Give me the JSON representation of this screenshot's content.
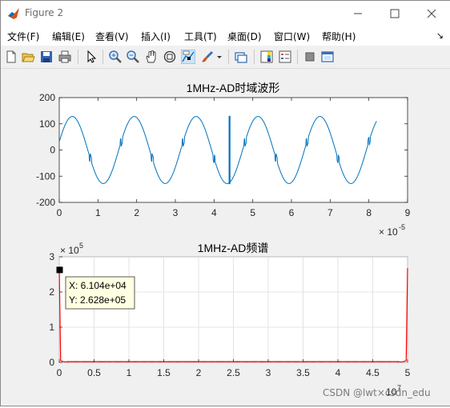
{
  "window": {
    "title": "Figure 2"
  },
  "menu": {
    "items": [
      "文件(F)",
      "编辑(E)",
      "查看(V)",
      "插入(I)",
      "工具(T)",
      "桌面(D)",
      "窗口(W)",
      "帮助(H)"
    ],
    "overflow_glyph": "↘"
  },
  "toolbar": {
    "icons": [
      "new-figure-icon",
      "open-file-icon",
      "save-icon",
      "print-icon",
      "pointer-icon",
      "zoom-in-icon",
      "zoom-out-icon",
      "pan-icon",
      "rotate-3d-icon",
      "data-cursor-icon",
      "brush-icon",
      "brush-dropdown-icon",
      "link-plot-icon",
      "insert-colorbar-icon",
      "insert-legend-icon",
      "hide-plot-tools-icon",
      "show-plot-tools-icon"
    ]
  },
  "chart_data": [
    {
      "type": "line",
      "title": "1MHz-AD时域波形",
      "xlabel": "",
      "ylabel": "",
      "xlim": [
        0,
        9
      ],
      "ylim": [
        -200,
        200
      ],
      "x_multiplier_label": "× 10",
      "x_multiplier_exponent": "-5",
      "xticks": [
        "0",
        "1",
        "2",
        "3",
        "4",
        "5",
        "6",
        "7",
        "8",
        "9"
      ],
      "yticks": [
        "200",
        "100",
        "0",
        "-100",
        "-200"
      ],
      "grid": false,
      "color": "#0072bd",
      "series": [
        {
          "description_free": true,
          "amplitude": 128,
          "period_x": 1.6,
          "x_end": 8.2,
          "glitch_x": [
            0.8,
            1.6,
            2.4,
            3.2,
            4.0,
            4.8,
            5.6,
            6.4,
            7.2,
            8.0
          ],
          "spike_x": 4.4,
          "spike_range": [
            -130,
            130
          ]
        }
      ]
    },
    {
      "type": "line",
      "title": "1MHz-AD频谱",
      "xlabel": "",
      "ylabel": "",
      "xlim": [
        0,
        5
      ],
      "ylim": [
        0,
        3
      ],
      "x_multiplier_label": "10",
      "x_multiplier_exponent": "7",
      "y_multiplier_label": "× 10",
      "y_multiplier_exponent": "5",
      "xticks": [
        "0",
        "0.5",
        "1",
        "1.5",
        "2",
        "2.5",
        "3",
        "3.5",
        "4",
        "4.5",
        "5"
      ],
      "yticks": [
        "3",
        "2",
        "1",
        "0"
      ],
      "grid": true,
      "color": "#ff0000",
      "peak_left": 2.628,
      "peak_right": 2.628,
      "datatip": {
        "x": 0.006104,
        "y": 2.628,
        "line1": "X: 6.104e+04",
        "line2": "Y: 2.628e+05"
      }
    }
  ],
  "watermark": "CSDN @lwt×csdn_edu"
}
